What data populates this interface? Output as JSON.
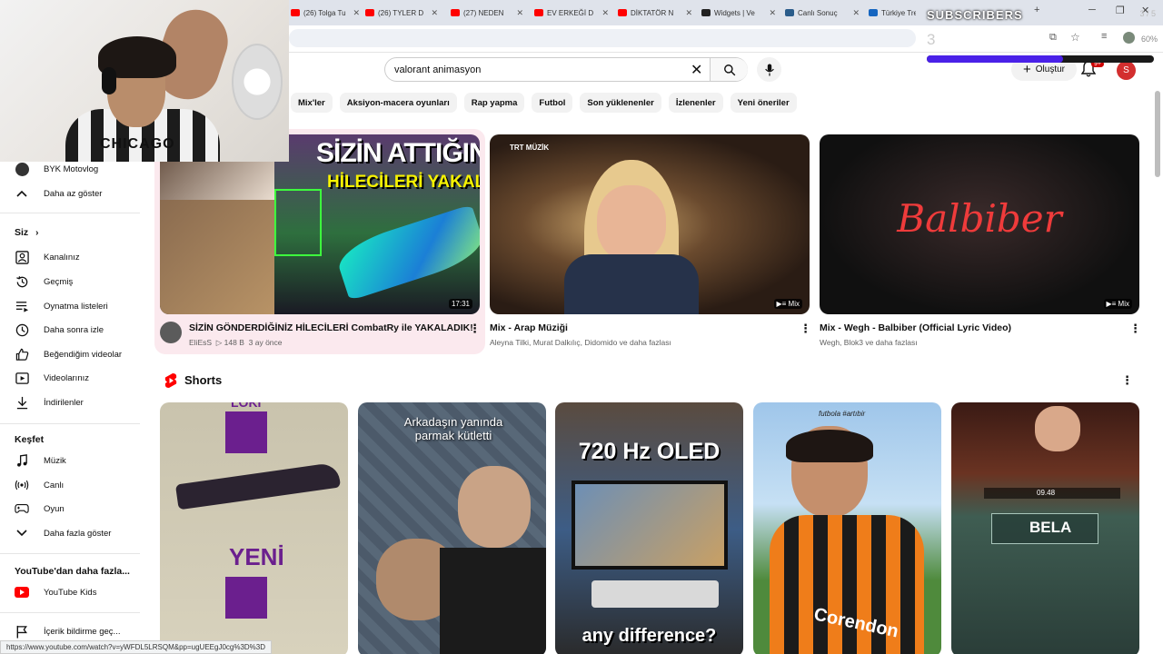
{
  "browser": {
    "tabs": [
      {
        "label": "(26) Tolga Tu",
        "color": "#ff0000"
      },
      {
        "label": "(26) TYLER D",
        "color": "#ff0000"
      },
      {
        "label": "(27) NEDEN",
        "color": "#ff0000"
      },
      {
        "label": "EV ERKEĞİ D",
        "color": "#ff0000"
      },
      {
        "label": "DİKTATÖR N",
        "color": "#ff0000"
      },
      {
        "label": "Widgets | Ve",
        "color": "#222222"
      },
      {
        "label": "Canlı Sonuç",
        "color": "#2a5c8a"
      },
      {
        "label": "Türkiye Tre",
        "color": "#1565c0"
      }
    ],
    "new_tab": "+",
    "status_url": "https://www.youtube.com/watch?v=yWFDL5LRSQM&pp=ugUEEgJ0cg%3D%3D"
  },
  "widget": {
    "label": "SUBSCRIBERS",
    "goal": "3 / 5",
    "count": "3",
    "progress": 0.6,
    "percent": "60%"
  },
  "webcam": {
    "shirt_text": "CHICAGO"
  },
  "header": {
    "search_value": "valorant animasyon",
    "create_label": "Oluştur",
    "notif_badge": "9+",
    "avatar_letter": "S"
  },
  "chips": [
    "Mix'ler",
    "Aksiyon-macera oyunları",
    "Rap yapma",
    "Futbol",
    "Son yüklenenler",
    "İzlenenler",
    "Yeni öneriler"
  ],
  "sidebar": {
    "top_items": [
      {
        "label": "BYK Motovlog",
        "icon": "channel-avatar-icon"
      },
      {
        "label": "Daha az göster",
        "icon": "chevron-up-icon"
      }
    ],
    "you_heading": "Siz",
    "you_items": [
      {
        "label": "Kanalınız",
        "icon": "channel-icon"
      },
      {
        "label": "Geçmiş",
        "icon": "history-icon"
      },
      {
        "label": "Oynatma listeleri",
        "icon": "playlist-icon"
      },
      {
        "label": "Daha sonra izle",
        "icon": "watch-later-icon"
      },
      {
        "label": "Beğendiğim videolar",
        "icon": "like-icon"
      },
      {
        "label": "Videolarınız",
        "icon": "your-videos-icon"
      },
      {
        "label": "İndirilenler",
        "icon": "download-icon"
      }
    ],
    "explore_heading": "Keşfet",
    "explore_items": [
      {
        "label": "Müzik",
        "icon": "music-icon"
      },
      {
        "label": "Canlı",
        "icon": "live-icon"
      },
      {
        "label": "Oyun",
        "icon": "gaming-icon"
      },
      {
        "label": "Daha fazla göster",
        "icon": "chevron-down-icon"
      }
    ],
    "more_heading": "YouTube'dan daha fazla...",
    "more_items": [
      {
        "label": "YouTube Kids",
        "icon": "youtube-kids-icon"
      }
    ],
    "bottom_items": [
      {
        "label": "İçerik bildirme geç...",
        "icon": "flag-icon"
      }
    ]
  },
  "videos": [
    {
      "title": "SİZİN GÖNDERDİĞİNİZ HİLECİLERİ CombatRy ile YAKALADIK!",
      "channel": "EliEsS",
      "views": "▷ 148 B",
      "age": "3 ay önce",
      "duration": "17:31",
      "thumb_text_1": "SİZİN ATTIĞINIZ",
      "thumb_text_2": "HİLECİLERİ YAKALADIK"
    },
    {
      "title": "Mix - Arap Müziği",
      "channel": "Aleyna Tilki, Murat Dalkılıç, Didomido ve daha fazlası",
      "badge": "Mix",
      "thumb_logo": "TRT MÜZİK"
    },
    {
      "title": "Mix - Wegh - Balbiber (Official Lyric Video)",
      "channel": "Wegh, Blok3 ve daha fazlası",
      "badge": "Mix",
      "thumb_text": "Balbiber"
    }
  ],
  "shorts": {
    "heading": "Shorts",
    "items": [
      {
        "top": "LOKI",
        "mid": "YENİ"
      },
      {
        "top": "Arkadaşın yanında parmak kütletti"
      },
      {
        "top": "720 Hz OLED",
        "bottom": "any difference?"
      },
      {
        "top": "futbola #artıbir",
        "mid": "Corendon"
      },
      {
        "top": "09.48",
        "mid": "BELA"
      }
    ]
  }
}
